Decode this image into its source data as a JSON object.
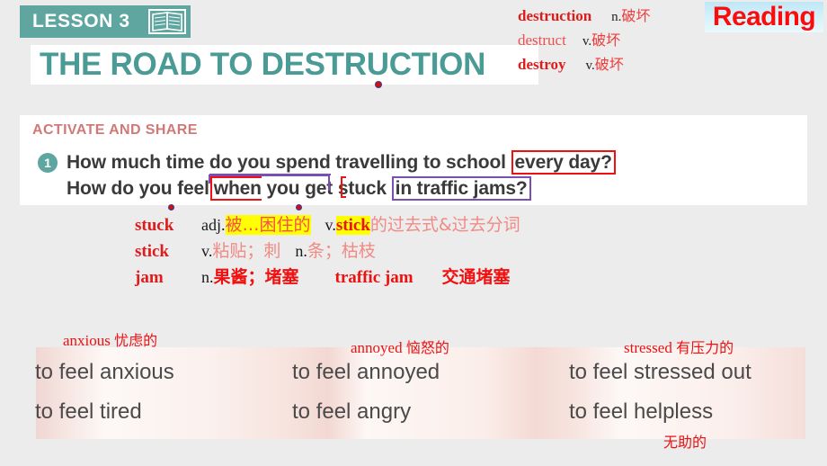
{
  "header": {
    "lesson_label": "LESSON 3",
    "book_icon": "open-book-icon",
    "title": "THE ROAD TO DESTRUCTION",
    "reading_label": "Reading"
  },
  "vocab_top": [
    {
      "word": "destruction",
      "pos": "n.",
      "meaning": "破坏",
      "bold": true
    },
    {
      "word": "destruct",
      "pos": "v.",
      "meaning": "破坏",
      "bold": false
    },
    {
      "word": "destroy",
      "pos": "v.",
      "meaning": "破坏",
      "bold": true
    }
  ],
  "panel": {
    "section_heading": "ACTIVATE AND SHARE",
    "question_number": "1",
    "question_parts": {
      "p1": "How much time ",
      "p2_underlined": "do you spend",
      "p3": " travelling to school ",
      "p4_bracketed": "every day?",
      "p5": "How do you feel",
      "p6_bracketed": "when",
      "p7": "you get stuck ",
      "p8_boxed": "in traffic jams?"
    }
  },
  "vocab_mid": [
    {
      "word": "stuck",
      "pos": "adj.",
      "meaning_hl": "被…困住的",
      "pos2": "v.",
      "word2_hl": "stick",
      "meaning2": "的过去式&过去分词"
    },
    {
      "word": "stick",
      "pos": "v.",
      "meaning_hl": "粘贴；刺",
      "pos2": "n.",
      "meaning2": "条；枯枝"
    },
    {
      "word": "jam",
      "pos": "n.",
      "meaning_hl": "果酱；堵塞",
      "phrase": "traffic jam",
      "phrase_cn": "交通堵塞"
    }
  ],
  "photo_band": {
    "cells": [
      {
        "text": "to feel anxious"
      },
      {
        "text": "to feel annoyed"
      },
      {
        "text": "to feel stressed out"
      },
      {
        "text": "to feel tired"
      },
      {
        "text": "to feel angry"
      },
      {
        "text": "to feel helpless"
      }
    ],
    "notes": [
      {
        "en": "anxious",
        "cn": "忧虑的"
      },
      {
        "en": "annoyed",
        "cn": "恼怒的"
      },
      {
        "en": "stressed",
        "cn": "有压力的"
      },
      {
        "en": "",
        "cn": "无助的"
      }
    ]
  },
  "colors": {
    "teal": "#5fa5a0",
    "title_teal": "#4a9b95",
    "red": "#ee1111",
    "purple": "#7a4fb5",
    "highlight_yellow": "#ffff00",
    "heading_rose": "#cf7a77",
    "background": "#ececec"
  }
}
